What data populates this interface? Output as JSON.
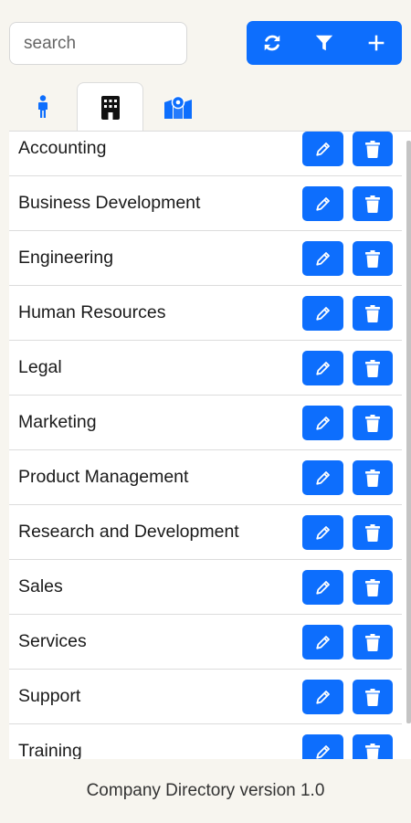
{
  "search": {
    "placeholder": "search",
    "value": ""
  },
  "toolbar": {
    "buttons": [
      {
        "icon": "refresh-icon"
      },
      {
        "icon": "filter-icon"
      },
      {
        "icon": "plus-icon"
      }
    ],
    "color": "#0d6efd"
  },
  "tabs": [
    {
      "icon": "person-icon",
      "active": false
    },
    {
      "icon": "building-icon",
      "active": true
    },
    {
      "icon": "map-location-icon",
      "active": false
    }
  ],
  "departments": [
    "Accounting",
    "Business Development",
    "Engineering",
    "Human Resources",
    "Legal",
    "Marketing",
    "Product Management",
    "Research and Development",
    "Sales",
    "Services",
    "Support",
    "Training"
  ],
  "row_actions": {
    "edit_icon": "pencil-icon",
    "delete_icon": "trash-icon"
  },
  "footer": {
    "text": "Company Directory version 1.0"
  }
}
